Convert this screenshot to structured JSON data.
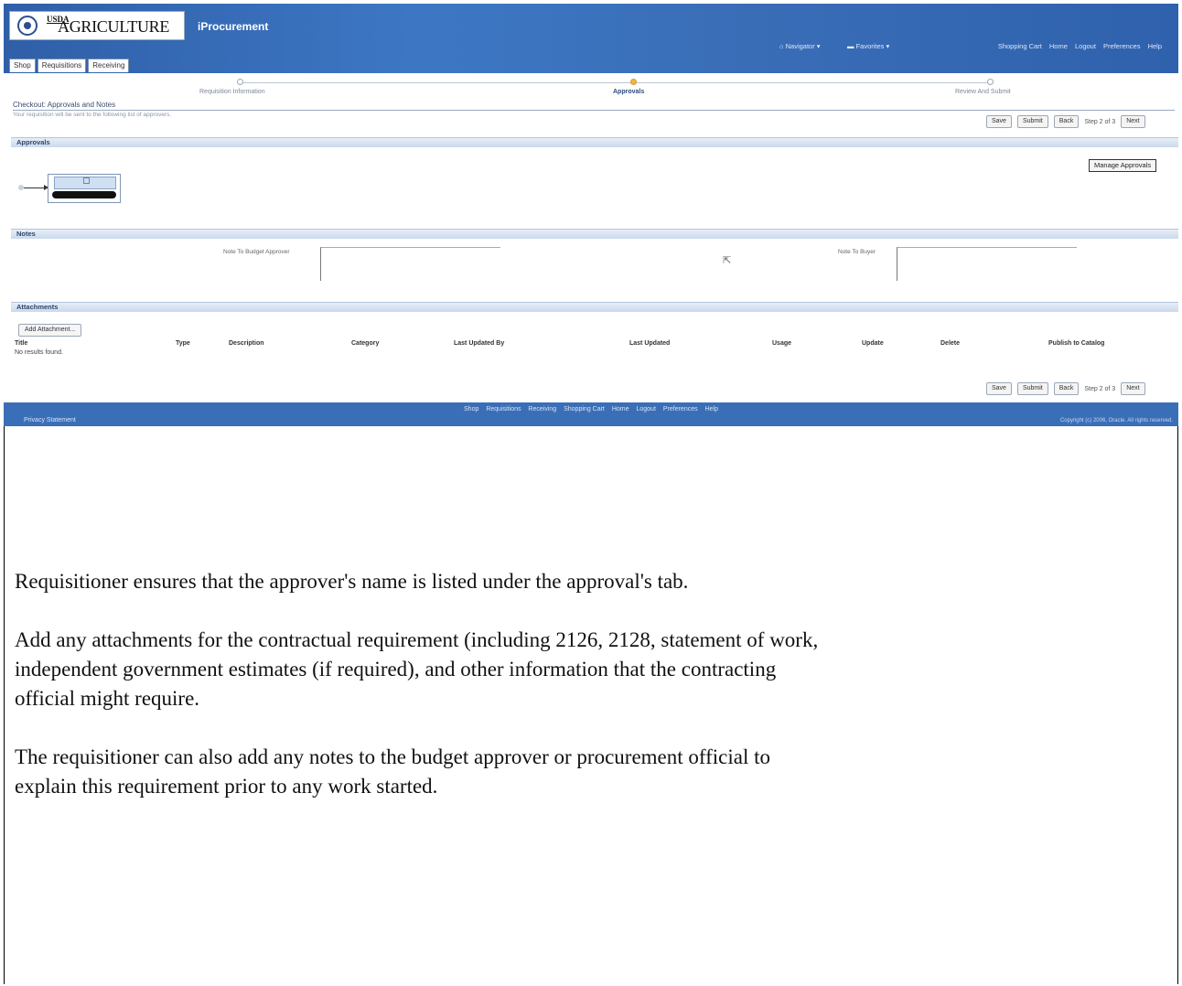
{
  "header": {
    "logo_usda": "USDA",
    "logo_text": "AGRICULTURE",
    "app_name": "iProcurement",
    "navigator_label": "Navigator ▾",
    "favorites_label": "Favorites ▾",
    "global_links": [
      "Shopping Cart",
      "Home",
      "Logout",
      "Preferences",
      "Help"
    ]
  },
  "tabs": [
    "Shop",
    "Requisitions",
    "Receiving"
  ],
  "train": {
    "steps": [
      "Requisition Information",
      "Approvals",
      "Review And Submit"
    ],
    "active_index": 1
  },
  "page": {
    "title": "Checkout: Approvals and Notes",
    "subtitle": "Your requisition will be sent to the following list of approvers."
  },
  "buttons": {
    "save": "Save",
    "submit": "Submit",
    "back": "Back",
    "step": "Step 2 of 3",
    "next": "Next"
  },
  "approvals": {
    "section_title": "Approvals",
    "manage_button": "Manage Approvals"
  },
  "notes": {
    "section_title": "Notes",
    "budget_label": "Note To Budget Approver",
    "buyer_label": "Note To Buyer"
  },
  "attachments": {
    "section_title": "Attachments",
    "add_button": "Add Attachment...",
    "columns": [
      "Title",
      "Type",
      "Description",
      "Category",
      "Last Updated By",
      "Last Updated",
      "Usage",
      "Update",
      "Delete",
      "Publish to Catalog"
    ],
    "empty_text": "No results found."
  },
  "footer": {
    "links": [
      "Shop",
      "Requisitions",
      "Receiving",
      "Shopping Cart",
      "Home",
      "Logout",
      "Preferences",
      "Help"
    ],
    "privacy": "Privacy Statement",
    "copyright": "Copyright (c) 2006, Oracle. All rights reserved."
  },
  "instructions": {
    "p1": "Requisitioner ensures that the approver's name is listed under the approval's tab.",
    "p2": "Add any attachments for the contractual requirement (including 2126, 2128, statement of work, independent government estimates (if required), and other information that the contracting official might require.",
    "p3": "The requisitioner can also add any notes to the budget approver or procurement official to explain this requirement prior to any work started."
  },
  "colors": {
    "brand_blue": "#3a6fb8",
    "train_active": "#f0b64a"
  }
}
